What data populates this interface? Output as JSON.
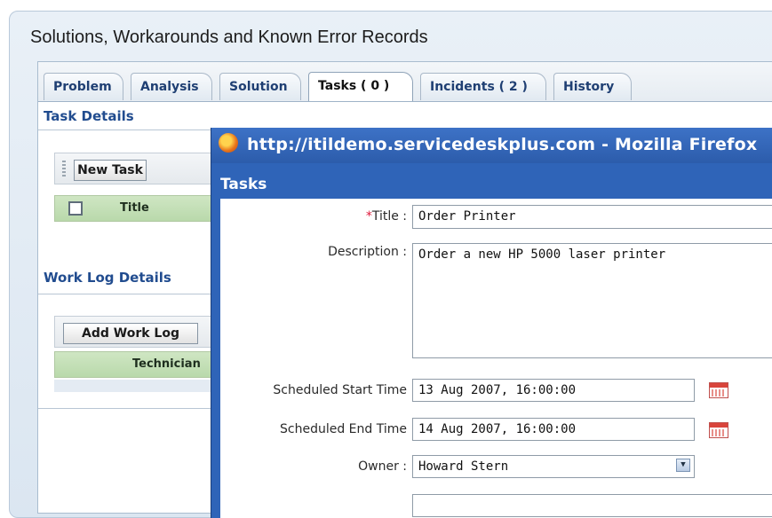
{
  "page": {
    "heading": "Solutions, Workarounds and Known Error Records"
  },
  "tabs": [
    {
      "label": "Problem"
    },
    {
      "label": "Analysis"
    },
    {
      "label": "Solution"
    },
    {
      "label": "Tasks ( 0 )"
    },
    {
      "label": "Incidents ( 2 )"
    },
    {
      "label": "History"
    }
  ],
  "task_details": {
    "title": "Task Details",
    "new_task_label": "New Task",
    "column_title": "Title"
  },
  "work_log": {
    "title": "Work Log Details",
    "add_label": "Add Work Log",
    "column_technician": "Technician"
  },
  "popup": {
    "window_title": "http://itildemo.servicedeskplus.com - Mozilla Firefox",
    "header": "Tasks",
    "fields": {
      "title_required_mark": "*",
      "title_label": "Title :",
      "title_value": "Order Printer",
      "description_label": "Description :",
      "description_value": "Order a new HP 5000 laser printer",
      "start_label": "Scheduled Start Time",
      "start_value": "13 Aug 2007, 16:00:00",
      "end_label": "Scheduled End Time",
      "end_value": "14 Aug 2007, 16:00:00",
      "owner_label": "Owner :",
      "owner_value": "Howard Stern"
    }
  }
}
